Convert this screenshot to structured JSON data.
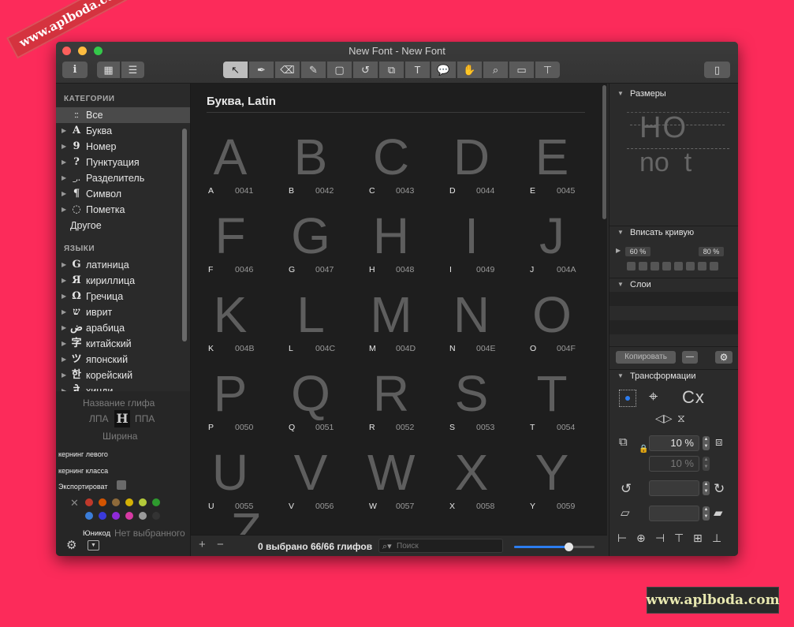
{
  "watermark": {
    "top": "www.aplboda.com",
    "bottom": "www.aplboda.com"
  },
  "window": {
    "title": "New Font - New Font"
  },
  "toolbar": {
    "info_icon": "i",
    "grid_icon": "▦",
    "list_icon": "☰",
    "tools": [
      {
        "name": "select-tool",
        "glyph": "↖"
      },
      {
        "name": "pen-tool",
        "glyph": "✒"
      },
      {
        "name": "eraser-tool",
        "glyph": "⌫"
      },
      {
        "name": "pencil-tool",
        "glyph": "✎"
      },
      {
        "name": "rectangle-tool",
        "glyph": "▢"
      },
      {
        "name": "rotate-tool",
        "glyph": "↺"
      },
      {
        "name": "scale-tool",
        "glyph": "⧉"
      },
      {
        "name": "text-tool",
        "glyph": "T"
      },
      {
        "name": "annotation-tool",
        "glyph": "💬"
      },
      {
        "name": "hand-tool",
        "glyph": "✋"
      },
      {
        "name": "zoom-tool",
        "glyph": "⌕"
      },
      {
        "name": "measure-tool",
        "glyph": "▭"
      },
      {
        "name": "kern-tool",
        "glyph": "⊤"
      }
    ],
    "panel_toggle_icon": "▯"
  },
  "sidebar": {
    "categories_header": "КАТЕГОРИИ",
    "categories": [
      {
        "icon": "⁚⁚",
        "label": "Все",
        "arrow": ""
      },
      {
        "icon": "A",
        "label": "Буква",
        "arrow": "▶"
      },
      {
        "icon": "9",
        "label": "Номер",
        "arrow": "▶"
      },
      {
        "icon": "?",
        "label": "Пунктуация",
        "arrow": "▶"
      },
      {
        "icon": "_,.",
        "label": "Разделитель",
        "arrow": "▶"
      },
      {
        "icon": "¶",
        "label": "Символ",
        "arrow": "▶"
      },
      {
        "icon": "◌",
        "label": "Пометка",
        "arrow": "▶"
      },
      {
        "icon": "",
        "label": "Другое",
        "arrow": ""
      }
    ],
    "languages_header": "ЯЗЫКИ",
    "languages": [
      {
        "icon": "G",
        "label": "латиница"
      },
      {
        "icon": "Я",
        "label": "кириллица"
      },
      {
        "icon": "Ω",
        "label": "Гречица"
      },
      {
        "icon": "ש",
        "label": "иврит"
      },
      {
        "icon": "ض",
        "label": "арабица"
      },
      {
        "icon": "字",
        "label": "китайский"
      },
      {
        "icon": "ツ",
        "label": "японский"
      },
      {
        "icon": "한",
        "label": "корейский"
      },
      {
        "icon": "ने",
        "label": "хинди"
      }
    ]
  },
  "glyph_info": {
    "name_label": "Название глифа",
    "left_label": "ЛПА",
    "right_label": "ППА",
    "preview_glyph": "H",
    "width_label": "Ширина",
    "kerning_left": "кернинг левого",
    "kerning_class": "кернинг класса",
    "export_label": "Экспортироват",
    "clear_color_icon": "✕",
    "colors": [
      "#c0392b",
      "#d35400",
      "#8e6a3a",
      "#d4b106",
      "#b3c93a",
      "#2e9a2e",
      "#3b7dd8",
      "#3a3adb",
      "#8e2ad8",
      "#d63aa3",
      "#9a9a9a",
      "#333333"
    ],
    "unicode_label": "Юникод",
    "unicode_value": "Нет выбранного"
  },
  "center": {
    "heading": "Буква, Latin",
    "glyphs": [
      {
        "char": "A",
        "code": "0041"
      },
      {
        "char": "B",
        "code": "0042"
      },
      {
        "char": "C",
        "code": "0043"
      },
      {
        "char": "D",
        "code": "0044"
      },
      {
        "char": "E",
        "code": "0045"
      },
      {
        "char": "F",
        "code": "0046"
      },
      {
        "char": "G",
        "code": "0047"
      },
      {
        "char": "H",
        "code": "0048"
      },
      {
        "char": "I",
        "code": "0049"
      },
      {
        "char": "J",
        "code": "004A"
      },
      {
        "char": "K",
        "code": "004B"
      },
      {
        "char": "L",
        "code": "004C"
      },
      {
        "char": "M",
        "code": "004D"
      },
      {
        "char": "N",
        "code": "004E"
      },
      {
        "char": "O",
        "code": "004F"
      },
      {
        "char": "P",
        "code": "0050"
      },
      {
        "char": "Q",
        "code": "0051"
      },
      {
        "char": "R",
        "code": "0052"
      },
      {
        "char": "S",
        "code": "0053"
      },
      {
        "char": "T",
        "code": "0054"
      },
      {
        "char": "U",
        "code": "0055"
      },
      {
        "char": "V",
        "code": "0056"
      },
      {
        "char": "W",
        "code": "0057"
      },
      {
        "char": "X",
        "code": "0058"
      },
      {
        "char": "Y",
        "code": "0059"
      }
    ],
    "partial_glyph": "Z",
    "add_label": "+",
    "remove_label": "−",
    "status": "0 выбрано 66/66 глифов",
    "search_placeholder": "Поиск",
    "zoom_fraction": 0.68
  },
  "right_panel": {
    "dimensions_header": "Размеры",
    "dim_preview_top": "HO",
    "dim_preview_bottom": "no  t",
    "fit_curve_header": "Вписать кривую",
    "fit_left": "60 %",
    "fit_right": "80 %",
    "layers_header": "Слои",
    "copy_button": "Копировать",
    "minus_button": "—",
    "gear_icon": "⚙",
    "transform_header": "Трансформации",
    "transform_text": "Cx",
    "scale_value": "10 %",
    "scale_value2": "10 %"
  }
}
